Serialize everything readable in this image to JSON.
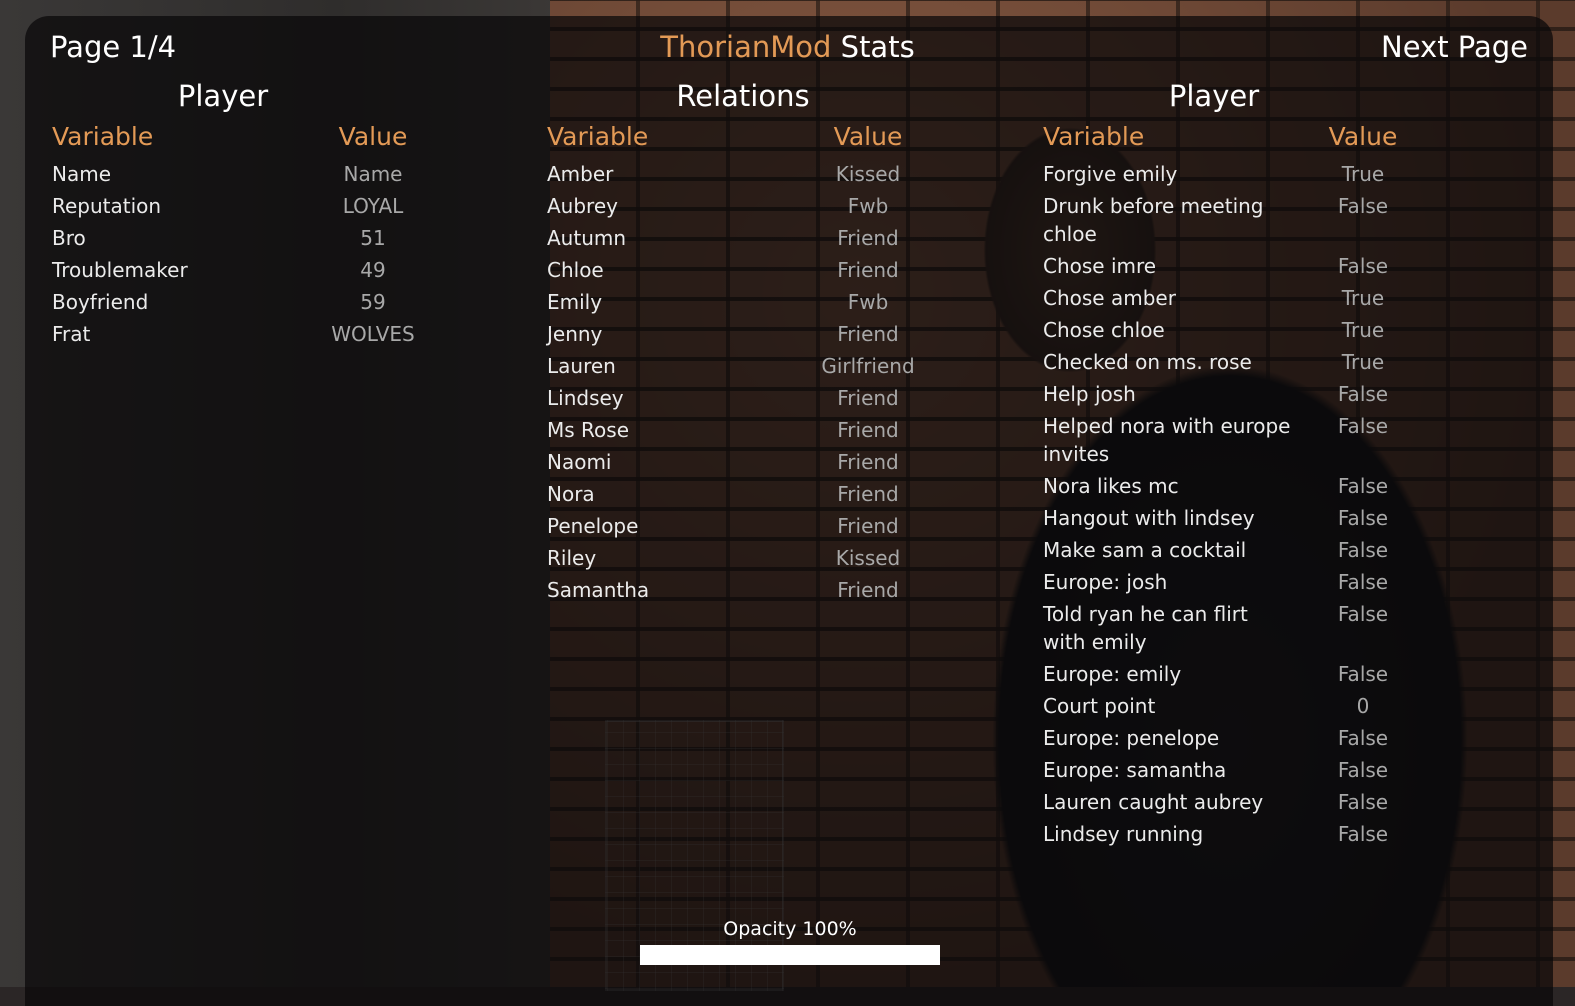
{
  "header": {
    "page_label": "Page 1/4",
    "title_mod": "ThorianMod",
    "title_rest": " Stats",
    "next_label": "Next Page"
  },
  "player": {
    "title": "Player",
    "col_variable": "Variable",
    "col_value": "Value",
    "rows": [
      {
        "variable": "Name",
        "value": "Name"
      },
      {
        "variable": "Reputation",
        "value": "LOYAL"
      },
      {
        "variable": "Bro",
        "value": "51"
      },
      {
        "variable": "Troublemaker",
        "value": "49"
      },
      {
        "variable": "Boyfriend",
        "value": "59"
      },
      {
        "variable": "Frat",
        "value": "WOLVES"
      }
    ]
  },
  "relations": {
    "title": "Relations",
    "col_variable": "Variable",
    "col_value": "Value",
    "rows": [
      {
        "variable": "Amber",
        "value": "Kissed"
      },
      {
        "variable": "Aubrey",
        "value": "Fwb"
      },
      {
        "variable": "Autumn",
        "value": "Friend"
      },
      {
        "variable": "Chloe",
        "value": "Friend"
      },
      {
        "variable": "Emily",
        "value": "Fwb"
      },
      {
        "variable": "Jenny",
        "value": "Friend"
      },
      {
        "variable": "Lauren",
        "value": "Girlfriend"
      },
      {
        "variable": "Lindsey",
        "value": "Friend"
      },
      {
        "variable": "Ms Rose",
        "value": "Friend"
      },
      {
        "variable": "Naomi",
        "value": "Friend"
      },
      {
        "variable": "Nora",
        "value": "Friend"
      },
      {
        "variable": "Penelope",
        "value": "Friend"
      },
      {
        "variable": "Riley",
        "value": "Kissed"
      },
      {
        "variable": "Samantha",
        "value": "Friend"
      }
    ]
  },
  "flags": {
    "title": "Player",
    "col_variable": "Variable",
    "col_value": "Value",
    "rows": [
      {
        "variable": "Forgive emily",
        "value": "True"
      },
      {
        "variable": "Drunk before meeting chloe",
        "value": "False"
      },
      {
        "variable": "Chose imre",
        "value": "False"
      },
      {
        "variable": "Chose amber",
        "value": "True"
      },
      {
        "variable": "Chose chloe",
        "value": "True"
      },
      {
        "variable": "Checked on ms. rose",
        "value": "True"
      },
      {
        "variable": "Help josh",
        "value": "False"
      },
      {
        "variable": "Helped nora with europe invites",
        "value": "False"
      },
      {
        "variable": "Nora likes mc",
        "value": "False"
      },
      {
        "variable": "Hangout with lindsey",
        "value": "False"
      },
      {
        "variable": "Make sam a cocktail",
        "value": "False"
      },
      {
        "variable": "Europe: josh",
        "value": "False"
      },
      {
        "variable": "Told ryan he can flirt with emily",
        "value": "False"
      },
      {
        "variable": "Europe: emily",
        "value": "False"
      },
      {
        "variable": "Court point",
        "value": "0"
      },
      {
        "variable": "Europe: penelope",
        "value": "False"
      },
      {
        "variable": "Europe: samantha",
        "value": "False"
      },
      {
        "variable": "Lauren caught aubrey",
        "value": "False"
      },
      {
        "variable": "Lindsey running",
        "value": "False"
      }
    ]
  },
  "opacity": {
    "label": "Opacity 100%",
    "level": 1.0
  },
  "colors": {
    "accent": "#e39a56",
    "text": "#ebebeb",
    "value_text": "#a8a8a8"
  }
}
